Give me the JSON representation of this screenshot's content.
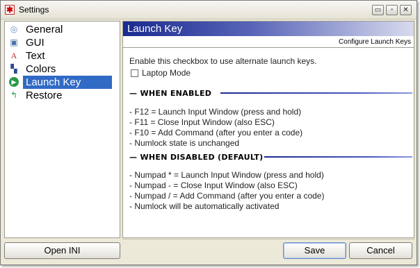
{
  "window": {
    "title": "Settings",
    "controls": {
      "minimize": "▭",
      "maximize": "▫",
      "close": "✕"
    }
  },
  "nav": {
    "items": [
      {
        "label": "General",
        "icon": "general-icon"
      },
      {
        "label": "GUI",
        "icon": "gui-icon"
      },
      {
        "label": "Text",
        "icon": "text-icon"
      },
      {
        "label": "Colors",
        "icon": "colors-icon"
      },
      {
        "label": "Launch Key",
        "icon": "launch-key-icon",
        "selected": true
      },
      {
        "label": "Restore",
        "icon": "restore-icon"
      }
    ]
  },
  "panel": {
    "title": "Launch Key",
    "subtitle": "Configure Launch Keys",
    "intro": "Enable this checkbox to use alternate launch keys.",
    "checkbox_label": "Laptop Mode",
    "enabled_heading": "WHEN ENABLED",
    "enabled_lines": [
      "- F12 = Launch Input Window (press and hold)",
      "- F11 = Close Input Window (also ESC)",
      "- F10 = Add Command (after you enter a code)",
      "- Numlock state is unchanged"
    ],
    "disabled_heading": "WHEN DISABLED (DEFAULT)",
    "disabled_lines": [
      "- Numpad * = Launch Input Window (press and hold)",
      "- Numpad - = Close Input Window (also ESC)",
      "- Numpad / = Add Command (after you enter a code)",
      "- Numlock will be automatically activated"
    ]
  },
  "buttons": {
    "open_ini": "Open INI",
    "save": "Save",
    "cancel": "Cancel"
  },
  "colors": {
    "header_start": "#1a2a90",
    "selection": "#316ac5"
  }
}
